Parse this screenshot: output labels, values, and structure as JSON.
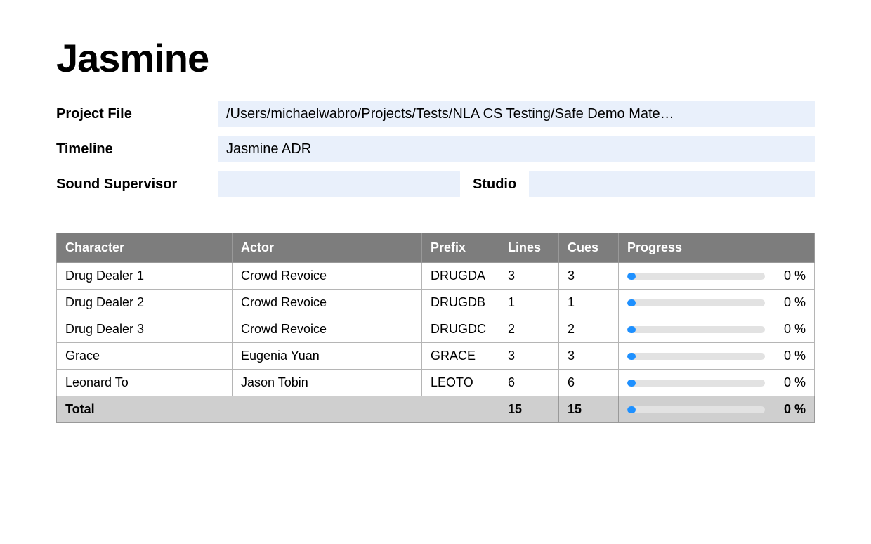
{
  "title": "Jasmine",
  "meta": {
    "project_file_label": "Project File",
    "project_file_value": "/Users/michaelwabro/Projects/Tests/NLA CS Testing/Safe Demo Mate…",
    "timeline_label": "Timeline",
    "timeline_value": "Jasmine ADR",
    "sound_supervisor_label": "Sound Supervisor",
    "sound_supervisor_value": "",
    "studio_label": "Studio",
    "studio_value": ""
  },
  "table": {
    "headers": {
      "character": "Character",
      "actor": "Actor",
      "prefix": "Prefix",
      "lines": "Lines",
      "cues": "Cues",
      "progress": "Progress"
    },
    "rows": [
      {
        "character": "Drug Dealer 1",
        "actor": "Crowd Revoice",
        "prefix": "DRUGDA",
        "lines": "3",
        "cues": "3",
        "progress_pct": "0 %",
        "progress_fill": 4
      },
      {
        "character": "Drug Dealer 2",
        "actor": "Crowd Revoice",
        "prefix": "DRUGDB",
        "lines": "1",
        "cues": "1",
        "progress_pct": "0 %",
        "progress_fill": 4
      },
      {
        "character": "Drug Dealer 3",
        "actor": "Crowd Revoice",
        "prefix": "DRUGDC",
        "lines": "2",
        "cues": "2",
        "progress_pct": "0 %",
        "progress_fill": 4
      },
      {
        "character": "Grace",
        "actor": "Eugenia Yuan",
        "prefix": "GRACE",
        "lines": "3",
        "cues": "3",
        "progress_pct": "0 %",
        "progress_fill": 4
      },
      {
        "character": "Leonard To",
        "actor": "Jason Tobin",
        "prefix": "LEOTO",
        "lines": "6",
        "cues": "6",
        "progress_pct": "0 %",
        "progress_fill": 4
      }
    ],
    "total": {
      "label": "Total",
      "lines": "15",
      "cues": "15",
      "progress_pct": "0 %",
      "progress_fill": 4
    }
  }
}
